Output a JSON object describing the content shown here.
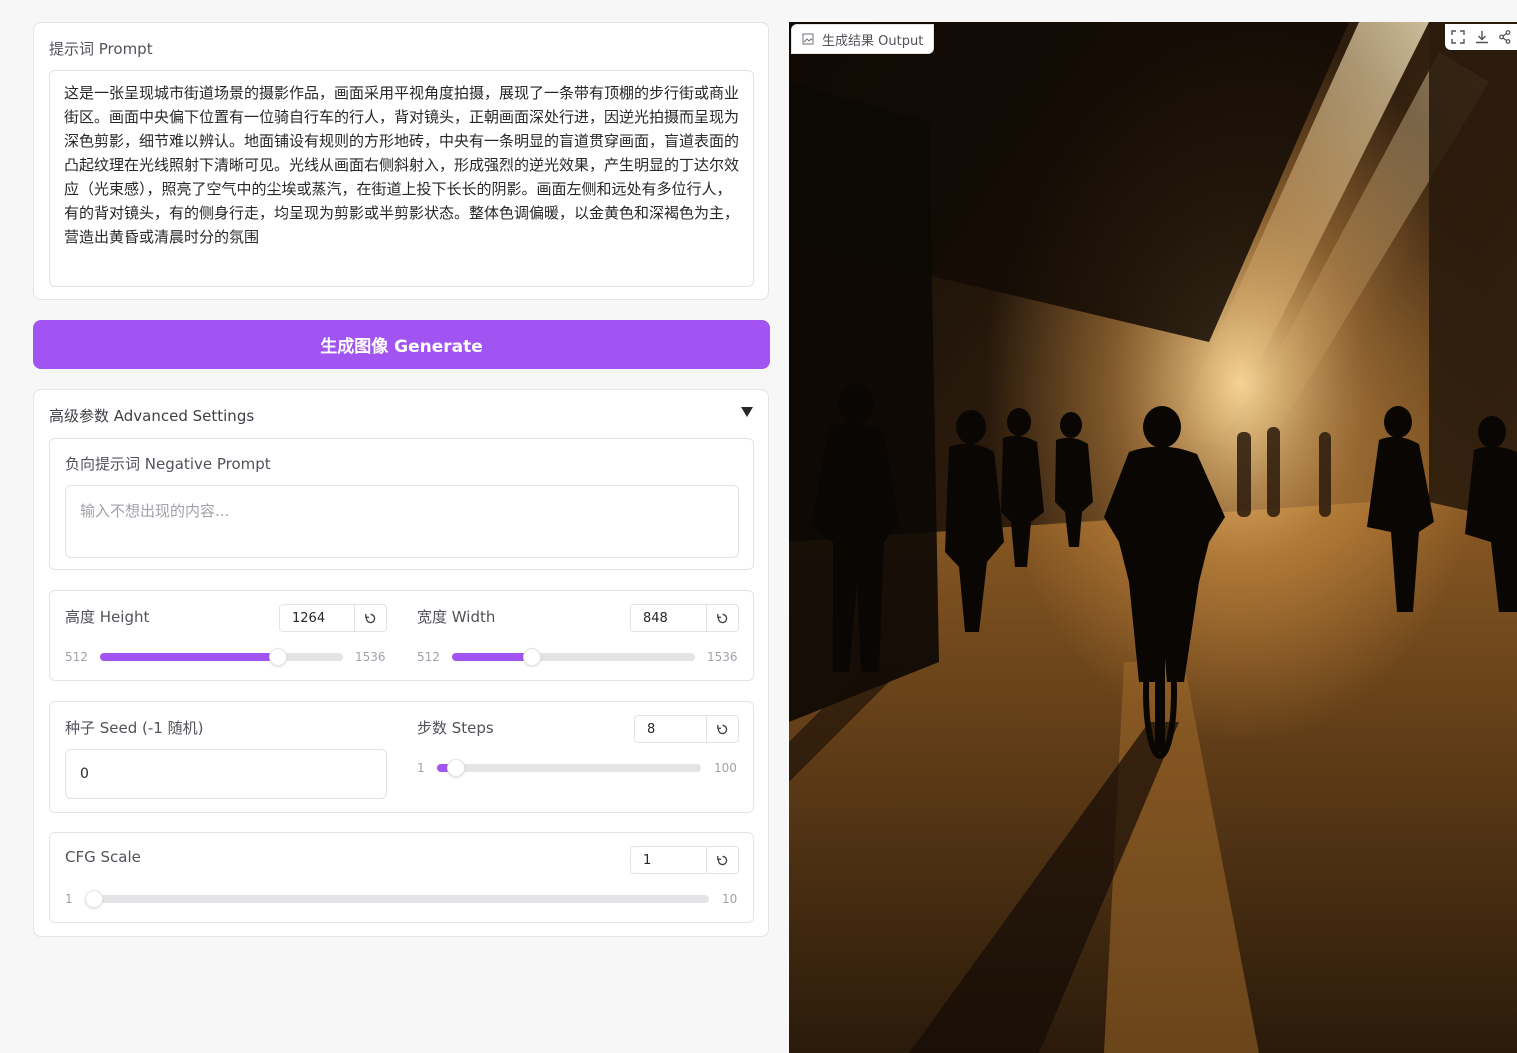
{
  "prompt": {
    "label": "提示词 Prompt",
    "text": "这是一张呈现城市街道场景的摄影作品，画面采用平视角度拍摄，展现了一条带有顶棚的步行街或商业街区。画面中央偏下位置有一位骑自行车的行人，背对镜头，正朝画面深处行进，因逆光拍摄而呈现为深色剪影，细节难以辨认。地面铺设有规则的方形地砖，中央有一条明显的盲道贯穿画面，盲道表面的凸起纹理在光线照射下清晰可见。光线从画面右侧斜射入，形成强烈的逆光效果，产生明显的丁达尔效应（光束感），照亮了空气中的尘埃或蒸汽，在街道上投下长长的阴影。画面左侧和远处有多位行人，有的背对镜头，有的侧身行走，均呈现为剪影或半剪影状态。整体色调偏暖，以金黄色和深褐色为主，营造出黄昏或清晨时分的氛围"
  },
  "generate_button": "生成图像 Generate",
  "advanced": {
    "title": "高级参数 Advanced Settings",
    "negative_prompt": {
      "label": "负向提示词 Negative Prompt",
      "placeholder": "输入不想出现的内容..."
    },
    "height": {
      "label": "高度 Height",
      "value": "1264",
      "min": "512",
      "max": "1536",
      "fraction": 0.734
    },
    "width": {
      "label": "宽度 Width",
      "value": "848",
      "min": "512",
      "max": "1536",
      "fraction": 0.328
    },
    "seed": {
      "label": "种子 Seed (-1 随机)",
      "value": "0"
    },
    "steps": {
      "label": "步数 Steps",
      "value": "8",
      "min": "1",
      "max": "100",
      "fraction": 0.071
    },
    "cfg": {
      "label": "CFG Scale",
      "value": "1",
      "min": "1",
      "max": "10",
      "fraction": 0.0
    }
  },
  "output": {
    "label": "生成结果 Output",
    "image_description_icon": "image-icon"
  },
  "colors": {
    "accent": "#a154f2",
    "track": "#e4e4e7"
  }
}
